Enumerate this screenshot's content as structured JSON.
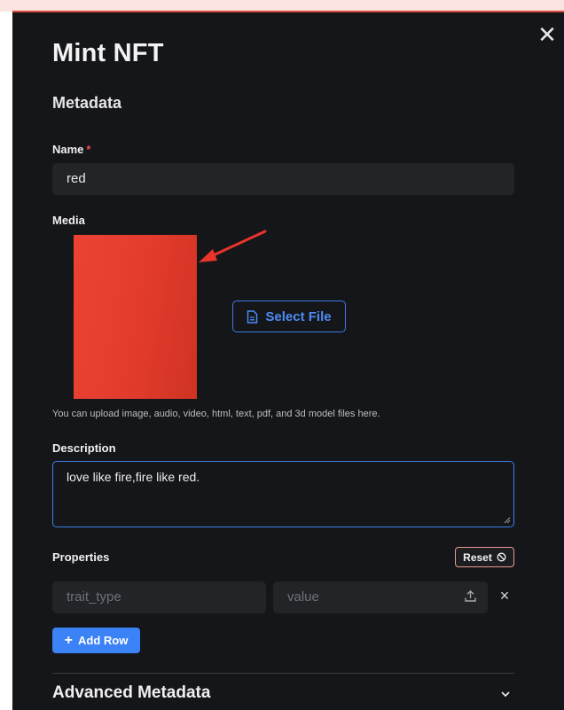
{
  "modal": {
    "title": "Mint NFT",
    "close_symbol": "✕"
  },
  "metadata": {
    "heading": "Metadata",
    "name": {
      "label": "Name",
      "required_marker": "*",
      "value": "red"
    },
    "media": {
      "label": "Media",
      "preview_color": "#e23b2c",
      "select_file_label": "Select File",
      "hint": "You can upload image, audio, video, html, text, pdf, and 3d model files here."
    },
    "description": {
      "label": "Description",
      "value": "love like fire,fire like red."
    },
    "properties": {
      "label": "Properties",
      "reset_label": "Reset",
      "rows": [
        {
          "trait_type_placeholder": "trait_type",
          "value_placeholder": "value",
          "remove_symbol": "×"
        }
      ],
      "add_row_label": "Add Row"
    },
    "advanced": {
      "label": "Advanced Metadata"
    }
  },
  "colors": {
    "panel_bg": "#151619",
    "input_bg": "#232428",
    "accent_blue": "#3b82f6",
    "annotation_arrow": "#e8342b"
  }
}
